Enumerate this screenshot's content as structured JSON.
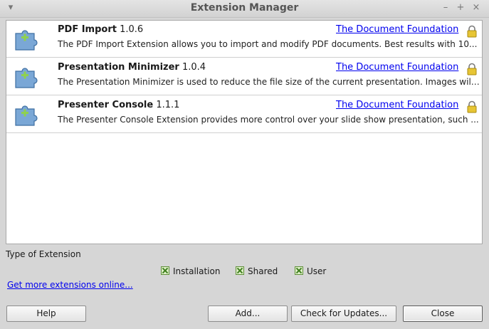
{
  "window": {
    "title": "Extension Manager",
    "controls": {
      "menu": "▾",
      "minimize": "–",
      "maximize": "+",
      "close": "×"
    }
  },
  "extensions": [
    {
      "name": "PDF Import",
      "version": "1.0.6",
      "publisher": "The Document Foundation",
      "description": "The PDF Import Extension allows you to import and modify PDF documents. Best results with 10..."
    },
    {
      "name": "Presentation Minimizer",
      "version": "1.0.4",
      "publisher": "The Document Foundation",
      "description": "The Presentation Minimizer is used to reduce the file size of the current presentation. Images will..."
    },
    {
      "name": "Presenter Console",
      "version": "1.1.1",
      "publisher": "The Document Foundation",
      "description": "The Presenter Console Extension provides more control over your slide show presentation, such ..."
    }
  ],
  "filter": {
    "label": "Type of Extension",
    "options": [
      {
        "label": "Installation",
        "checked": true
      },
      {
        "label": "Shared",
        "checked": true
      },
      {
        "label": "User",
        "checked": true
      }
    ]
  },
  "more_link": "Get more extensions online...",
  "buttons": {
    "help": "Help",
    "add": "Add...",
    "check_updates": "Check for Updates...",
    "close": "Close"
  },
  "icons": {
    "extension": "puzzle-piece-icon",
    "lock": "lock-icon"
  }
}
